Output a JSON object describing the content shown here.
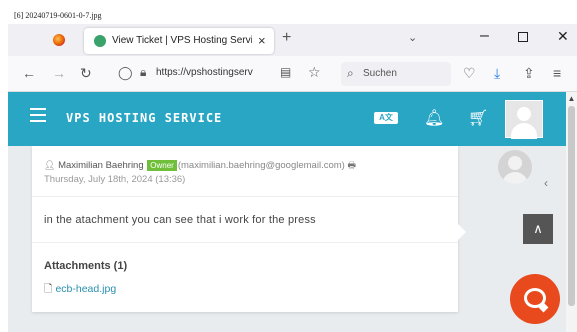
{
  "caption": "[6] 20240719-0601-0-7.jpg",
  "browser": {
    "tab_title": "View Ticket | VPS Hosting Servic",
    "tab_close": "×",
    "new_tab": "+",
    "tab_list": "⌄",
    "url": "https://vpshostingserv",
    "search_placeholder": "Suchen"
  },
  "header": {
    "brand": "VPS HOSTING SERVICE",
    "translate_label": "A文"
  },
  "message": {
    "author": "Maximilian Baehring",
    "badge": "Owner",
    "email": "(maximilian.baehring@googlemail.com)",
    "date": "Thursday, July 18th, 2024 (13:36)",
    "text": "in the atachment you can see that i work for the press",
    "attachments_title": "Attachments (1)",
    "attachment_file": "ecb-head.jpg"
  },
  "icons": {
    "menu": "menu-icon",
    "bell": "bell-icon",
    "cart": "cart-icon",
    "chat": "chat-icon",
    "scroll_top": "chevron-up-icon"
  },
  "colors": {
    "header": "#2aa6c5",
    "badge": "#6fbf3a",
    "chat": "#e8491d",
    "link": "#2a8fb0"
  }
}
